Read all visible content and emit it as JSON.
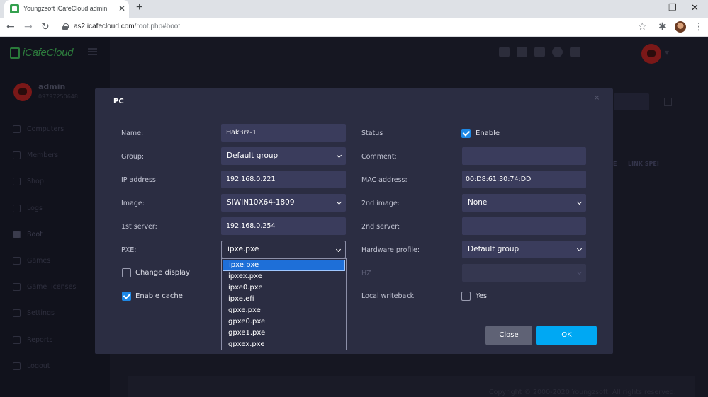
{
  "browser": {
    "tab_title": "Youngzsoft iCafeCloud admin",
    "tab_close": "✕",
    "new_tab": "+",
    "url_host": "as2.icafecloud.com",
    "url_path": "/root.php#boot",
    "window_controls": [
      "–",
      "❐",
      "✕"
    ],
    "nav_icons": [
      "←",
      "→",
      "↻"
    ],
    "right_icons": [
      "☆",
      "✱",
      "⋮"
    ]
  },
  "app": {
    "logo_text": "iCafeCloud",
    "user": {
      "name": "admin",
      "phone": "09797250648"
    },
    "menu": [
      {
        "label": "Computers",
        "icon": "monitor-icon"
      },
      {
        "label": "Members",
        "icon": "members-icon"
      },
      {
        "label": "Shop",
        "icon": "cart-icon"
      },
      {
        "label": "Logs",
        "icon": "logs-icon"
      },
      {
        "label": "Boot",
        "icon": "boot-icon",
        "active": true
      },
      {
        "label": "Games",
        "icon": "games-icon"
      },
      {
        "label": "Game licenses",
        "icon": "license-icon"
      },
      {
        "label": "Settings",
        "icon": "settings-icon"
      },
      {
        "label": "Reports",
        "icon": "reports-icon"
      },
      {
        "label": "Logout",
        "icon": "logout-icon"
      }
    ],
    "bg_columns": [
      "E",
      "LINK SPEI"
    ],
    "footer": "Copyright © 2000-2020 Youngzsoft. All rights reserved."
  },
  "modal": {
    "title": "PC",
    "close_x": "×",
    "labels": {
      "name": "Name:",
      "group": "Group:",
      "ip": "IP address:",
      "image": "Image:",
      "server1": "1st server:",
      "pxe": "PXE:",
      "status": "Status",
      "comment": "Comment:",
      "mac": "MAC address:",
      "image2": "2nd image:",
      "server2": "2nd server:",
      "hardware": "Hardware profile:",
      "hz": "HZ",
      "local_writeback": "Local writeback"
    },
    "values": {
      "name": "Hak3rz-1",
      "group": "Default group",
      "ip": "192.168.0.221",
      "image": "SIWIN10X64-1809",
      "server1": "192.168.0.254",
      "pxe": "ipxe.pxe",
      "comment": "",
      "mac": "00:D8:61:30:74:DD",
      "image2": "None",
      "server2": "",
      "hardware": "Default group",
      "hz": ""
    },
    "checkboxes": {
      "status": {
        "label": "Enable",
        "checked": true
      },
      "change_display": {
        "label": "Change display",
        "checked": false
      },
      "enable_cache": {
        "label": "Enable cache",
        "checked": true
      },
      "local_writeback": {
        "label": "Yes",
        "checked": false
      }
    },
    "pxe_options": [
      "ipxe.pxe",
      "ipxex.pxe",
      "ipxe0.pxe",
      "ipxe.efi",
      "gpxe.pxe",
      "gpxe0.pxe",
      "gpxe1.pxe",
      "gpxex.pxe"
    ],
    "buttons": {
      "close": "Close",
      "ok": "OK"
    }
  }
}
